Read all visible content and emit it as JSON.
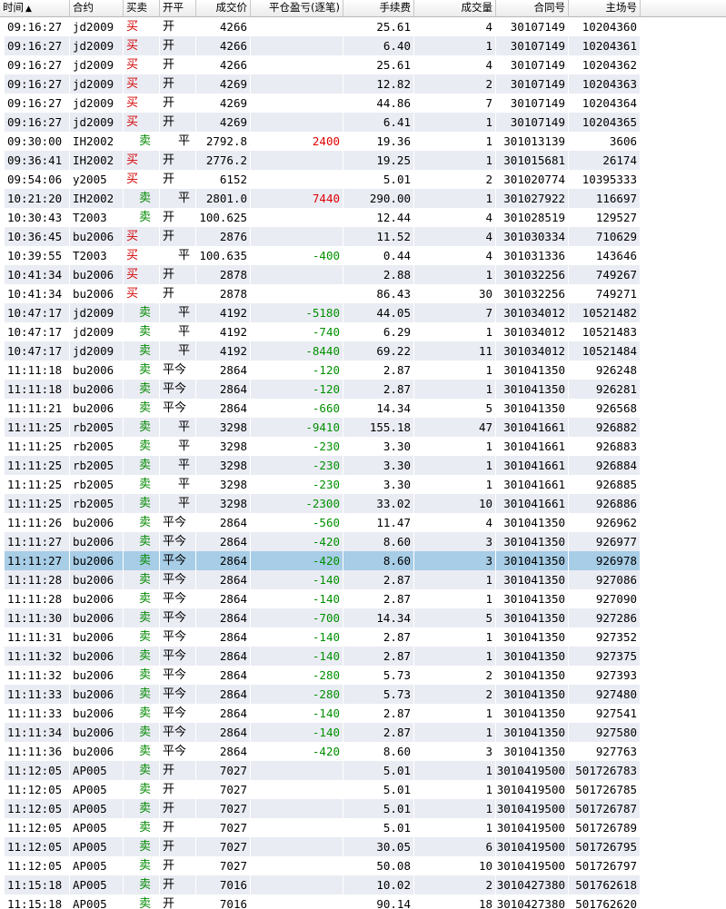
{
  "columns": {
    "time": "时间",
    "sort_indicator": "▲",
    "contract": "合约",
    "direction": "买卖",
    "openclose": "开平",
    "price": "成交价",
    "pnl": "平仓盈亏(逐笔)",
    "fee": "手续费",
    "volume": "成交量",
    "contract_no": "合同号",
    "exchange_no": "主场号"
  },
  "colors": {
    "buy": "#d40000",
    "sell": "#008a00",
    "profit": "#e00000",
    "loss": "#009000",
    "selected_row": "#a8cde6",
    "alt_row": "#eaecf4"
  },
  "selected_index": 28,
  "rows": [
    [
      "09:16:27",
      "jd2009",
      "买",
      "开",
      "4266",
      "",
      "25.61",
      "4",
      "30107149",
      "10204360"
    ],
    [
      "09:16:27",
      "jd2009",
      "买",
      "开",
      "4266",
      "",
      "6.40",
      "1",
      "30107149",
      "10204361"
    ],
    [
      "09:16:27",
      "jd2009",
      "买",
      "开",
      "4266",
      "",
      "25.61",
      "4",
      "30107149",
      "10204362"
    ],
    [
      "09:16:27",
      "jd2009",
      "买",
      "开",
      "4269",
      "",
      "12.82",
      "2",
      "30107149",
      "10204363"
    ],
    [
      "09:16:27",
      "jd2009",
      "买",
      "开",
      "4269",
      "",
      "44.86",
      "7",
      "30107149",
      "10204364"
    ],
    [
      "09:16:27",
      "jd2009",
      "买",
      "开",
      "4269",
      "",
      "6.41",
      "1",
      "30107149",
      "10204365"
    ],
    [
      "09:30:00",
      "IH2002",
      "卖",
      "平",
      "2792.8",
      "2400",
      "19.36",
      "1",
      "301013139",
      "3606"
    ],
    [
      "09:36:41",
      "IH2002",
      "买",
      "开",
      "2776.2",
      "",
      "19.25",
      "1",
      "301015681",
      "26174"
    ],
    [
      "09:54:06",
      "y2005",
      "买",
      "开",
      "6152",
      "",
      "5.01",
      "2",
      "301020774",
      "10395333"
    ],
    [
      "10:21:20",
      "IH2002",
      "卖",
      "平",
      "2801.0",
      "7440",
      "290.00",
      "1",
      "301027922",
      "116697"
    ],
    [
      "10:30:43",
      "T2003",
      "卖",
      "开",
      "100.625",
      "",
      "12.44",
      "4",
      "301028519",
      "129527"
    ],
    [
      "10:36:45",
      "bu2006",
      "买",
      "开",
      "2876",
      "",
      "11.52",
      "4",
      "301030334",
      "710629"
    ],
    [
      "10:39:55",
      "T2003",
      "买",
      "平",
      "100.635",
      "-400",
      "0.44",
      "4",
      "301031336",
      "143646"
    ],
    [
      "10:41:34",
      "bu2006",
      "买",
      "开",
      "2878",
      "",
      "2.88",
      "1",
      "301032256",
      "749267"
    ],
    [
      "10:41:34",
      "bu2006",
      "买",
      "开",
      "2878",
      "",
      "86.43",
      "30",
      "301032256",
      "749271"
    ],
    [
      "10:47:17",
      "jd2009",
      "卖",
      "平",
      "4192",
      "-5180",
      "44.05",
      "7",
      "301034012",
      "10521482"
    ],
    [
      "10:47:17",
      "jd2009",
      "卖",
      "平",
      "4192",
      "-740",
      "6.29",
      "1",
      "301034012",
      "10521483"
    ],
    [
      "10:47:17",
      "jd2009",
      "卖",
      "平",
      "4192",
      "-8440",
      "69.22",
      "11",
      "301034012",
      "10521484"
    ],
    [
      "11:11:18",
      "bu2006",
      "卖",
      "平今",
      "2864",
      "-120",
      "2.87",
      "1",
      "301041350",
      "926248"
    ],
    [
      "11:11:18",
      "bu2006",
      "卖",
      "平今",
      "2864",
      "-120",
      "2.87",
      "1",
      "301041350",
      "926281"
    ],
    [
      "11:11:21",
      "bu2006",
      "卖",
      "平今",
      "2864",
      "-660",
      "14.34",
      "5",
      "301041350",
      "926568"
    ],
    [
      "11:11:25",
      "rb2005",
      "卖",
      "平",
      "3298",
      "-9410",
      "155.18",
      "47",
      "301041661",
      "926882"
    ],
    [
      "11:11:25",
      "rb2005",
      "卖",
      "平",
      "3298",
      "-230",
      "3.30",
      "1",
      "301041661",
      "926883"
    ],
    [
      "11:11:25",
      "rb2005",
      "卖",
      "平",
      "3298",
      "-230",
      "3.30",
      "1",
      "301041661",
      "926884"
    ],
    [
      "11:11:25",
      "rb2005",
      "卖",
      "平",
      "3298",
      "-230",
      "3.30",
      "1",
      "301041661",
      "926885"
    ],
    [
      "11:11:25",
      "rb2005",
      "卖",
      "平",
      "3298",
      "-2300",
      "33.02",
      "10",
      "301041661",
      "926886"
    ],
    [
      "11:11:26",
      "bu2006",
      "卖",
      "平今",
      "2864",
      "-560",
      "11.47",
      "4",
      "301041350",
      "926962"
    ],
    [
      "11:11:27",
      "bu2006",
      "卖",
      "平今",
      "2864",
      "-420",
      "8.60",
      "3",
      "301041350",
      "926977"
    ],
    [
      "11:11:27",
      "bu2006",
      "卖",
      "平今",
      "2864",
      "-420",
      "8.60",
      "3",
      "301041350",
      "926978"
    ],
    [
      "11:11:28",
      "bu2006",
      "卖",
      "平今",
      "2864",
      "-140",
      "2.87",
      "1",
      "301041350",
      "927086"
    ],
    [
      "11:11:28",
      "bu2006",
      "卖",
      "平今",
      "2864",
      "-140",
      "2.87",
      "1",
      "301041350",
      "927090"
    ],
    [
      "11:11:30",
      "bu2006",
      "卖",
      "平今",
      "2864",
      "-700",
      "14.34",
      "5",
      "301041350",
      "927286"
    ],
    [
      "11:11:31",
      "bu2006",
      "卖",
      "平今",
      "2864",
      "-140",
      "2.87",
      "1",
      "301041350",
      "927352"
    ],
    [
      "11:11:32",
      "bu2006",
      "卖",
      "平今",
      "2864",
      "-140",
      "2.87",
      "1",
      "301041350",
      "927375"
    ],
    [
      "11:11:32",
      "bu2006",
      "卖",
      "平今",
      "2864",
      "-280",
      "5.73",
      "2",
      "301041350",
      "927393"
    ],
    [
      "11:11:33",
      "bu2006",
      "卖",
      "平今",
      "2864",
      "-280",
      "5.73",
      "2",
      "301041350",
      "927480"
    ],
    [
      "11:11:33",
      "bu2006",
      "卖",
      "平今",
      "2864",
      "-140",
      "2.87",
      "1",
      "301041350",
      "927541"
    ],
    [
      "11:11:34",
      "bu2006",
      "卖",
      "平今",
      "2864",
      "-140",
      "2.87",
      "1",
      "301041350",
      "927580"
    ],
    [
      "11:11:36",
      "bu2006",
      "卖",
      "平今",
      "2864",
      "-420",
      "8.60",
      "3",
      "301041350",
      "927763"
    ],
    [
      "11:12:05",
      "AP005",
      "卖",
      "开",
      "7027",
      "",
      "5.01",
      "1",
      "3010419500",
      "501726783"
    ],
    [
      "11:12:05",
      "AP005",
      "卖",
      "开",
      "7027",
      "",
      "5.01",
      "1",
      "3010419500",
      "501726785"
    ],
    [
      "11:12:05",
      "AP005",
      "卖",
      "开",
      "7027",
      "",
      "5.01",
      "1",
      "3010419500",
      "501726787"
    ],
    [
      "11:12:05",
      "AP005",
      "卖",
      "开",
      "7027",
      "",
      "5.01",
      "1",
      "3010419500",
      "501726789"
    ],
    [
      "11:12:05",
      "AP005",
      "卖",
      "开",
      "7027",
      "",
      "30.05",
      "6",
      "3010419500",
      "501726795"
    ],
    [
      "11:12:05",
      "AP005",
      "卖",
      "开",
      "7027",
      "",
      "50.08",
      "10",
      "3010419500",
      "501726797"
    ],
    [
      "11:15:18",
      "AP005",
      "卖",
      "开",
      "7016",
      "",
      "10.02",
      "2",
      "3010427380",
      "501762618"
    ],
    [
      "11:15:18",
      "AP005",
      "卖",
      "开",
      "7016",
      "",
      "90.14",
      "18",
      "3010427380",
      "501762620"
    ]
  ]
}
